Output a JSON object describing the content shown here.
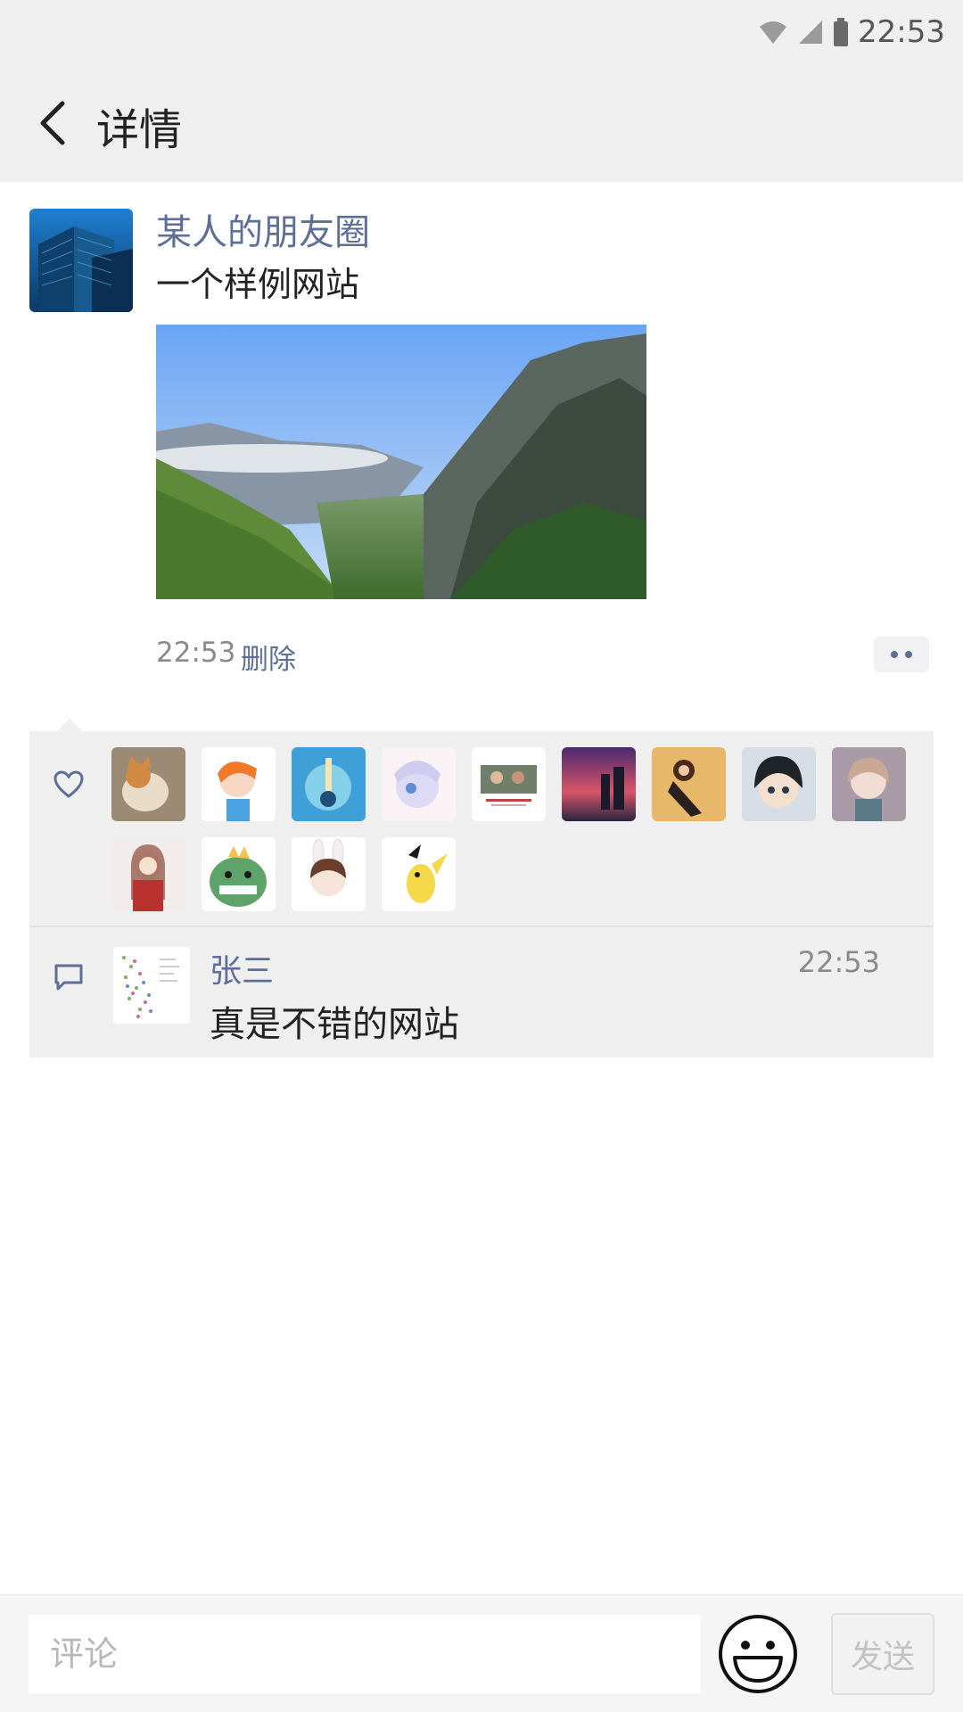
{
  "status_bar": {
    "time": "22:53",
    "icons": [
      "wifi-icon",
      "signal-icon",
      "battery-icon"
    ]
  },
  "app_bar": {
    "back_icon": "chevron-left-icon",
    "title": "详情"
  },
  "post": {
    "user_name": "某人的朋友圈",
    "text": "一个样例网站",
    "time": "22:53",
    "delete_label": "删除",
    "more_icon": "more-dots-icon"
  },
  "likes": {
    "icon": "heart-outline-icon",
    "count": 13
  },
  "comments": [
    {
      "user": "张三",
      "time": "22:53",
      "text": "真是不错的网站"
    }
  ],
  "comment_bar": {
    "placeholder": "评论",
    "emoji_icon": "smiley-icon",
    "send_label": "发送"
  },
  "colors": {
    "link": "#5d6f96",
    "panel": "#efefef",
    "muted": "#8a8a8a"
  }
}
